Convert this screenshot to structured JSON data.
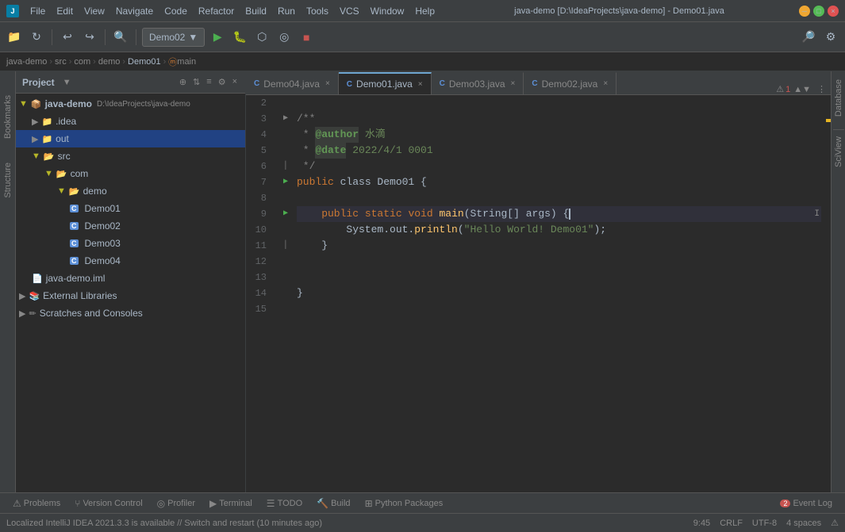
{
  "titleBar": {
    "appIcon": "J",
    "title": "java-demo [D:\\IdeaProjects\\java-demo] - Demo01.java",
    "menus": [
      "File",
      "Edit",
      "View",
      "Navigate",
      "Code",
      "Refactor",
      "Build",
      "Run",
      "Tools",
      "VCS",
      "Window",
      "Help"
    ]
  },
  "toolbar": {
    "runConfig": "Demo02",
    "breadcrumb": {
      "items": [
        "java-demo",
        "src",
        "com",
        "demo",
        "Demo01",
        "main"
      ],
      "separators": [
        ">",
        ">",
        ">",
        ">",
        ">"
      ]
    }
  },
  "projectPanel": {
    "title": "Project",
    "tree": [
      {
        "level": 0,
        "type": "root",
        "name": "java-demo",
        "suffix": "D:\\IdeaProjects\\java-demo",
        "expanded": true
      },
      {
        "level": 1,
        "type": "folder",
        "name": ".idea",
        "expanded": false
      },
      {
        "level": 1,
        "type": "folder",
        "name": "out",
        "expanded": false,
        "selected": false
      },
      {
        "level": 1,
        "type": "folder",
        "name": "src",
        "expanded": true
      },
      {
        "level": 2,
        "type": "folder",
        "name": "com",
        "expanded": true
      },
      {
        "level": 3,
        "type": "folder",
        "name": "demo",
        "expanded": true
      },
      {
        "level": 4,
        "type": "java",
        "name": "Demo01"
      },
      {
        "level": 4,
        "type": "java",
        "name": "Demo02"
      },
      {
        "level": 4,
        "type": "java",
        "name": "Demo03"
      },
      {
        "level": 4,
        "type": "java",
        "name": "Demo04"
      },
      {
        "level": 1,
        "type": "iml",
        "name": "java-demo.iml"
      },
      {
        "level": 0,
        "type": "extlib",
        "name": "External Libraries",
        "expanded": false
      },
      {
        "level": 0,
        "type": "scratch",
        "name": "Scratches and Consoles",
        "expanded": false
      }
    ]
  },
  "tabs": [
    {
      "name": "Demo04.java",
      "active": false,
      "modified": false
    },
    {
      "name": "Demo01.java",
      "active": true,
      "modified": false
    },
    {
      "name": "Demo03.java",
      "active": false,
      "modified": false
    },
    {
      "name": "Demo02.java",
      "active": false,
      "modified": false
    }
  ],
  "editor": {
    "lines": [
      {
        "num": 2,
        "tokens": []
      },
      {
        "num": 3,
        "tokens": [
          {
            "type": "cm",
            "text": "/**"
          }
        ],
        "gutter": "fold"
      },
      {
        "num": 4,
        "tokens": [
          {
            "type": "cm",
            "text": " * "
          },
          {
            "type": "cm-tag",
            "text": "@author"
          },
          {
            "type": "cm",
            "text": " "
          },
          {
            "type": "cm-val",
            "text": "水滴"
          }
        ]
      },
      {
        "num": 5,
        "tokens": [
          {
            "type": "cm",
            "text": " * "
          },
          {
            "type": "cm-tag",
            "text": "@date"
          },
          {
            "type": "cm",
            "text": " "
          },
          {
            "type": "cm-val",
            "text": "2022/4/1 0001"
          }
        ]
      },
      {
        "num": 6,
        "tokens": [
          {
            "type": "cm",
            "text": " */"
          }
        ],
        "gutter": "fold"
      },
      {
        "num": 7,
        "tokens": [
          {
            "type": "kw",
            "text": "public"
          },
          {
            "type": "type",
            "text": " class "
          },
          {
            "type": "type",
            "text": "Demo01"
          },
          {
            "type": "type",
            "text": " {"
          }
        ],
        "gutter": "run"
      },
      {
        "num": 8,
        "tokens": []
      },
      {
        "num": 9,
        "tokens": [
          {
            "type": "type",
            "text": "    "
          },
          {
            "type": "kw",
            "text": "public"
          },
          {
            "type": "type",
            "text": " "
          },
          {
            "type": "kw",
            "text": "static"
          },
          {
            "type": "type",
            "text": " "
          },
          {
            "type": "kw",
            "text": "void"
          },
          {
            "type": "type",
            "text": " "
          },
          {
            "type": "method",
            "text": "main"
          },
          {
            "type": "type",
            "text": "("
          },
          {
            "type": "type",
            "text": "String"
          },
          {
            "type": "type",
            "text": "[] args) {"
          },
          {
            "type": "cursor",
            "text": ""
          }
        ],
        "gutter": "run",
        "highlighted": true
      },
      {
        "num": 10,
        "tokens": [
          {
            "type": "type",
            "text": "        System."
          },
          {
            "type": "method",
            "text": "out"
          },
          {
            "type": "type",
            "text": "."
          },
          {
            "type": "method",
            "text": "println"
          },
          {
            "type": "type",
            "text": "("
          },
          {
            "type": "str",
            "text": "\"Hello World! Demo01\""
          },
          {
            "type": "type",
            "text": ");"
          }
        ]
      },
      {
        "num": 11,
        "tokens": [
          {
            "type": "type",
            "text": "    }"
          }
        ],
        "gutter": "fold"
      },
      {
        "num": 12,
        "tokens": []
      },
      {
        "num": 13,
        "tokens": []
      },
      {
        "num": 14,
        "tokens": [
          {
            "type": "type",
            "text": "}"
          }
        ]
      },
      {
        "num": 15,
        "tokens": []
      }
    ]
  },
  "bottomTabs": [
    {
      "name": "Problems",
      "icon": "⚠",
      "active": false
    },
    {
      "name": "Version Control",
      "icon": "⑂",
      "active": false
    },
    {
      "name": "Profiler",
      "icon": "◎",
      "active": false
    },
    {
      "name": "Terminal",
      "icon": "▶",
      "active": false
    },
    {
      "name": "TODO",
      "icon": "☰",
      "active": false
    },
    {
      "name": "Build",
      "icon": "🔨",
      "active": false
    },
    {
      "name": "Python Packages",
      "icon": "⊞",
      "active": false
    }
  ],
  "eventLog": {
    "label": "Event Log",
    "count": "2"
  },
  "statusBar": {
    "message": "Localized IntelliJ IDEA 2021.3.3 is available // Switch and restart (10 minutes ago)",
    "time": "9:45",
    "lineEnding": "CRLF",
    "encoding": "UTF-8",
    "indent": "4 spaces",
    "warningIcon": "⚠"
  },
  "rightSideTabs": [
    "Database",
    "SciView"
  ],
  "leftVTabs": [
    "Bookmarks",
    "Structure"
  ],
  "errors": {
    "count": "1",
    "upArrow": "▲",
    "downArrow": "▼"
  }
}
